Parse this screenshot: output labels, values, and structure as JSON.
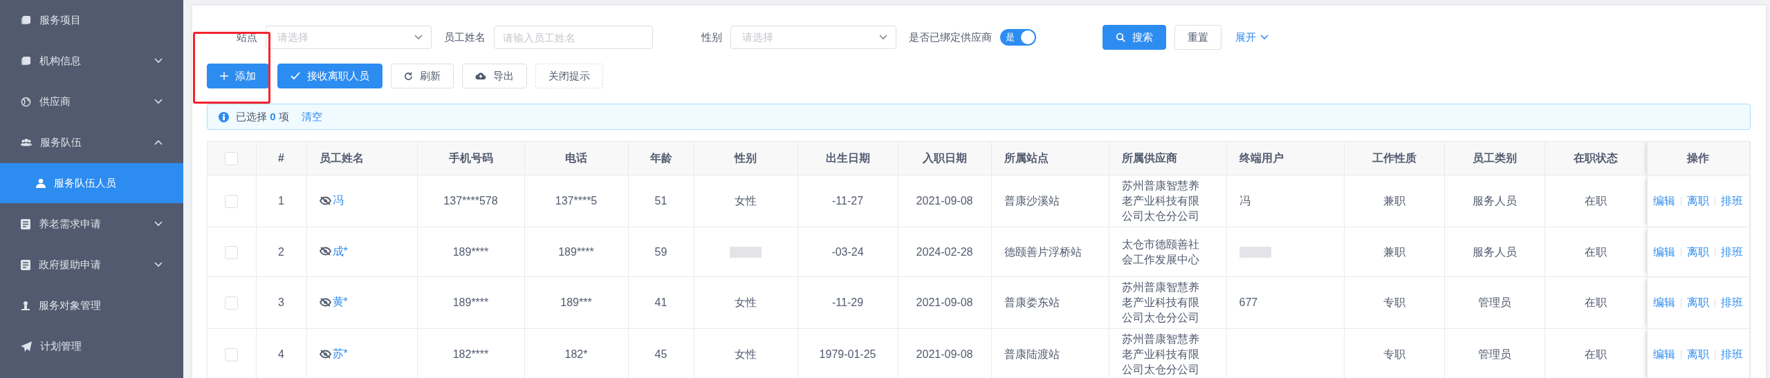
{
  "sidebar": {
    "items": [
      {
        "label": "服务项目",
        "kind": "folder",
        "expandable": false,
        "selected": false
      },
      {
        "label": "机构信息",
        "kind": "folder",
        "expandable": true,
        "expanded": false,
        "selected": false
      },
      {
        "label": "供应商",
        "kind": "globe",
        "expandable": true,
        "expanded": false,
        "selected": false
      },
      {
        "label": "服务队伍",
        "kind": "team",
        "expandable": true,
        "expanded": true,
        "selected": false,
        "children": [
          {
            "label": "服务队伍人员",
            "kind": "user",
            "selected": true
          }
        ]
      },
      {
        "label": "养老需求申请",
        "kind": "doc",
        "expandable": true,
        "expanded": false,
        "selected": false
      },
      {
        "label": "政府援助申请",
        "kind": "doc",
        "expandable": true,
        "expanded": false,
        "selected": false
      },
      {
        "label": "服务对象管理",
        "kind": "person",
        "expandable": false,
        "selected": false
      },
      {
        "label": "计划管理",
        "kind": "plane",
        "expandable": false,
        "selected": false
      }
    ]
  },
  "filters": [
    {
      "kind": "select",
      "label": "站点",
      "placeholder": "请选择"
    },
    {
      "kind": "input",
      "label": "员工姓名",
      "placeholder": "请输入员工姓名"
    },
    {
      "kind": "select",
      "label": "性别",
      "placeholder": "请选择"
    },
    {
      "kind": "switch",
      "label": "是否已绑定供应商",
      "on": true,
      "text": "是"
    }
  ],
  "filter_actions": [
    {
      "kind": "primary",
      "label": "搜索"
    },
    {
      "kind": "default",
      "label": "重置"
    },
    {
      "kind": "link",
      "label": "展开"
    }
  ],
  "toolbar": [
    {
      "kind": "primary",
      "label": "添加",
      "highlighted": true
    },
    {
      "kind": "primary",
      "label": "接收离职人员",
      "highlighted": false
    },
    {
      "kind": "default",
      "label": "刷新",
      "highlighted": false
    },
    {
      "kind": "default",
      "label": "导出",
      "highlighted": false
    },
    {
      "kind": "dashed",
      "label": "关闭提示",
      "highlighted": false
    }
  ],
  "selection_alert": {
    "prefix": "已选择",
    "count": "0",
    "suffix": "项",
    "clear": "清空"
  },
  "table": {
    "all_checked": false,
    "columns": [
      "#",
      "员工姓名",
      "手机号码",
      "电话",
      "年龄",
      "性别",
      "出生日期",
      "入职日期",
      "所属站点",
      "所属供应商",
      "终端用户",
      "工作性质",
      "员工类别",
      "在职状态",
      "操作"
    ],
    "rows": [
      {
        "checked": false,
        "cells": [
          "1",
          "冯",
          "137****578",
          "137****5",
          "51",
          "女性",
          "-11-27",
          "2021-09-08",
          "普康沙溪站",
          "苏州普康智慧养老产业科技有限公司太仓分公司",
          "冯",
          "兼职",
          "服务人员",
          "在职"
        ],
        "actions": [
          "编辑",
          "离职",
          "排班"
        ]
      },
      {
        "checked": false,
        "cells": [
          "2",
          "成*",
          "189****",
          "189****",
          "59",
          null,
          "-03-24",
          "2024-02-28",
          "德颐善片浮桥站",
          "太仓市德颐善社会工作发展中心",
          null,
          "兼职",
          "服务人员",
          "在职"
        ],
        "actions": [
          "编辑",
          "离职",
          "排班"
        ]
      },
      {
        "checked": false,
        "cells": [
          "3",
          "黄*",
          "189****",
          "189***",
          "41",
          "女性",
          "-11-29",
          "2021-09-08",
          "普康娄东站",
          "苏州普康智慧养老产业科技有限公司太仓分公司",
          "677",
          "专职",
          "管理员",
          "在职"
        ],
        "actions": [
          "编辑",
          "离职",
          "排班"
        ]
      },
      {
        "checked": false,
        "cells": [
          "4",
          "苏*",
          "182****",
          "182*",
          "45",
          "女性",
          "1979-01-25",
          "2021-09-08",
          "普康陆渡站",
          "苏州普康智慧养老产业科技有限公司太仓分公司",
          "",
          "专职",
          "管理员",
          "在职"
        ],
        "actions": [
          "编辑",
          "离职",
          "排班"
        ]
      }
    ]
  }
}
